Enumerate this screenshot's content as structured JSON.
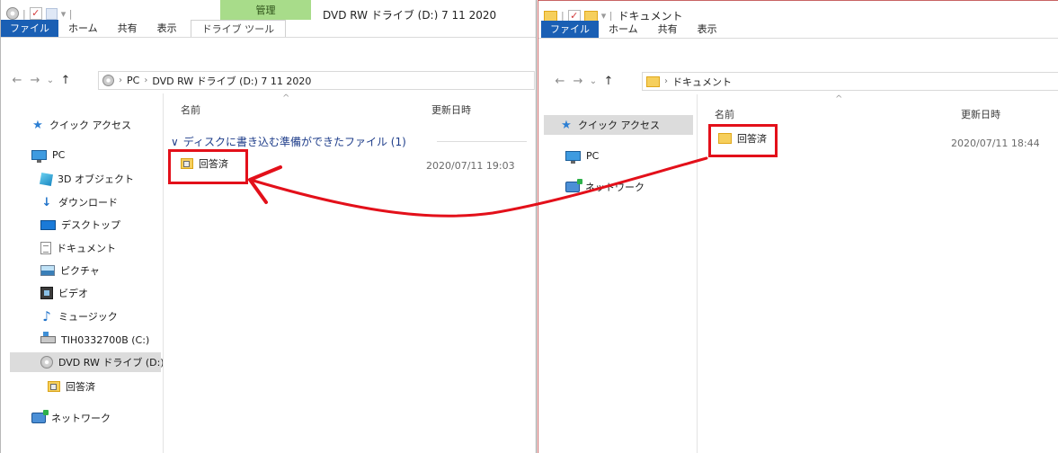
{
  "left_window": {
    "title": "DVD RW ドライブ (D:) 7 11 2020",
    "context_tab_header": "管理",
    "tabs": [
      "ファイル",
      "ホーム",
      "共有",
      "表示"
    ],
    "context_tab": "ドライブ ツール",
    "address_parts": [
      "PC",
      "DVD RW ドライブ (D:) 7 11 2020"
    ],
    "nav_items": [
      {
        "label": "クイック アクセス",
        "icon": "star-icon"
      },
      {
        "label": "PC",
        "icon": "pc-icon"
      },
      {
        "label": "3D オブジェクト",
        "icon": "3d-objects-icon"
      },
      {
        "label": "ダウンロード",
        "icon": "download-icon"
      },
      {
        "label": "デスクトップ",
        "icon": "desktop-icon"
      },
      {
        "label": "ドキュメント",
        "icon": "documents-icon"
      },
      {
        "label": "ピクチャ",
        "icon": "pictures-icon"
      },
      {
        "label": "ビデオ",
        "icon": "videos-icon"
      },
      {
        "label": "ミュージック",
        "icon": "music-icon"
      },
      {
        "label": "TIH0332700B (C:)",
        "icon": "drive-icon"
      },
      {
        "label": "DVD RW ドライブ (D:)",
        "icon": "disc-icon",
        "selected": true
      },
      {
        "label": "回答済",
        "icon": "pending-folder-icon"
      },
      {
        "label": "ネットワーク",
        "icon": "network-icon"
      }
    ],
    "columns": {
      "name": "名前",
      "modified": "更新日時"
    },
    "group": {
      "label": "ディスクに書き込む準備ができたファイル (1)"
    },
    "files": [
      {
        "name": "回答済",
        "modified": "2020/07/11 19:03",
        "icon": "pending-folder-icon"
      }
    ]
  },
  "right_window": {
    "title": "ドキュメント",
    "tabs": [
      "ファイル",
      "ホーム",
      "共有",
      "表示"
    ],
    "address_parts": [
      "ドキュメント"
    ],
    "nav_items": [
      {
        "label": "クイック アクセス",
        "icon": "star-icon",
        "selected": true
      },
      {
        "label": "PC",
        "icon": "pc-icon"
      },
      {
        "label": "ネットワーク",
        "icon": "network-icon"
      }
    ],
    "columns": {
      "name": "名前",
      "modified": "更新日時"
    },
    "files": [
      {
        "name": "回答済",
        "modified": "2020/07/11 18:44",
        "icon": "folder-icon"
      }
    ]
  },
  "annotation": {
    "highlight_color": "#e3101a",
    "arrow_color": "#e3101a"
  },
  "colors": {
    "accent": "#1a5fb4",
    "context_tab": "#a8dc8a",
    "selection": "#dcdcdc"
  }
}
